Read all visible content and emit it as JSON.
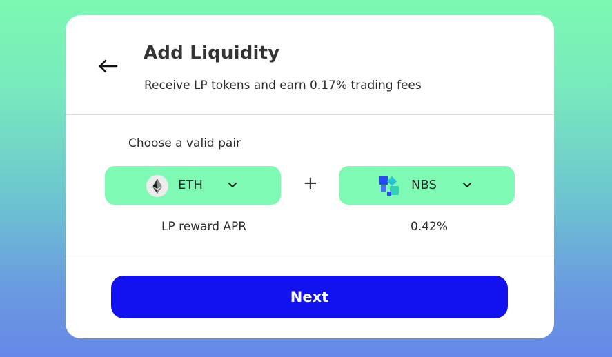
{
  "dialog": {
    "title": "Add Liquidity",
    "subtitle": "Receive LP tokens and earn 0.17% trading fees",
    "back_icon": "arrow-left-icon"
  },
  "pair": {
    "label": "Choose a valid pair",
    "token_a": {
      "symbol": "ETH",
      "icon": "eth-icon"
    },
    "separator": "+",
    "token_b": {
      "symbol": "NBS",
      "icon": "nbs-icon"
    }
  },
  "reward": {
    "label": "LP reward APR",
    "value": "0.42%"
  },
  "actions": {
    "next_label": "Next"
  },
  "colors": {
    "token_button_bg": "#7ffab4",
    "primary_button_bg": "#1212f0",
    "card_bg": "#ffffff",
    "nbs_blue": "#2a49ff",
    "nbs_teal": "#28c3d7"
  }
}
